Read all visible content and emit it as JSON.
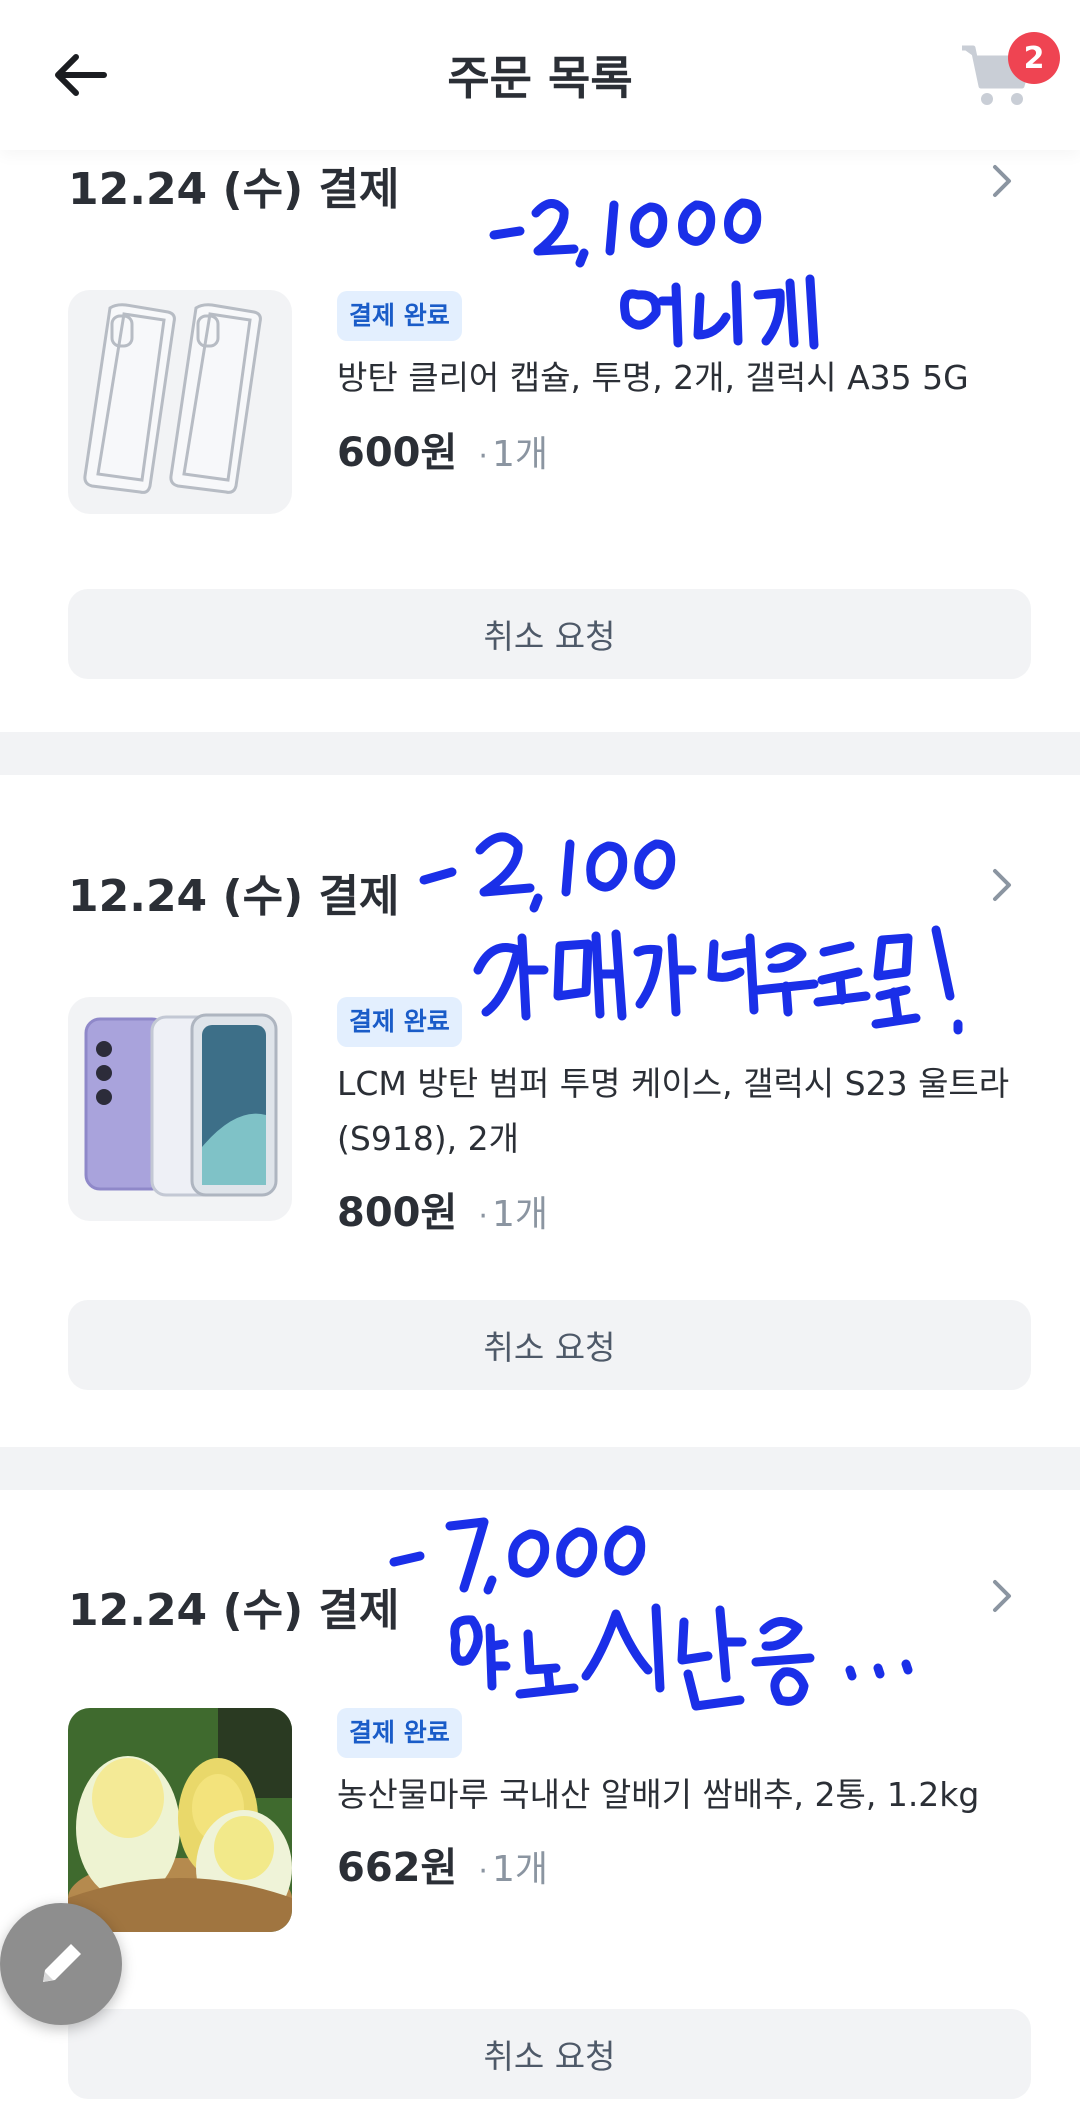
{
  "header": {
    "title": "주문 목록",
    "back_icon": "arrow-left-icon",
    "cart_icon": "cart-icon",
    "cart_count": "2"
  },
  "orders": [
    {
      "date": "12.24 (수) 결제",
      "status": "결제 완료",
      "product_name": "방탄 클리어 캡슐, 투명, 2개, 갤럭시 A35 5G",
      "price": "600원",
      "quantity": "1개",
      "cancel_label": "취소 요청",
      "thumbnail": "clear-phone-cases-image"
    },
    {
      "date": "12.24 (수) 결제",
      "status": "결제 완료",
      "product_name": "LCM 방탄 범퍼 투명 케이스, 갤럭시 S23 울트라 (S918), 2개",
      "price": "800원",
      "quantity": "1개",
      "cancel_label": "취소 요청",
      "thumbnail": "phone-bumper-case-image"
    },
    {
      "date": "12.24 (수) 결제",
      "status": "결제 완료",
      "product_name": "농산물마루 국내산 알배기 쌈배추, 2통, 1.2kg",
      "price": "662원",
      "quantity": "1개",
      "cancel_label": "취소 요청",
      "thumbnail": "napa-cabbage-image"
    }
  ],
  "handwritten_notes": [
    "-2,000 얼마게",
    "-2,000 카메라보호도 됨!.",
    "-7,000 여도 식단용 ..."
  ],
  "colors": {
    "accent_badge_bg": "#e3effe",
    "accent_badge_text": "#1a5cc8",
    "cart_badge": "#ef4452",
    "ink": "#1a2fe8"
  },
  "edit_icon": "pencil-icon"
}
